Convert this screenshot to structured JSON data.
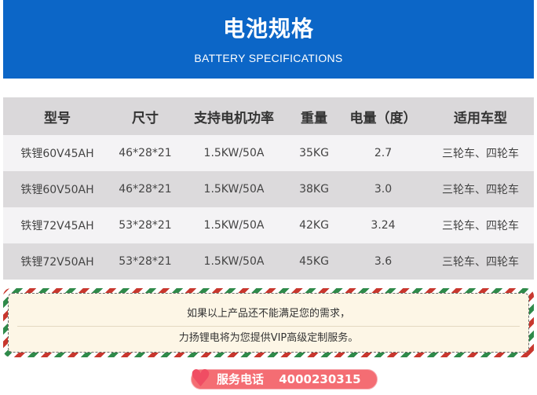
{
  "header": {
    "title": "电池规格",
    "subtitle": "BATTERY SPECIFICATIONS",
    "bg_color": "#0c66c7"
  },
  "table": {
    "columns": [
      "型号",
      "尺寸",
      "支持电机功率",
      "重量",
      "电量（度）",
      "适用车型"
    ],
    "rows": [
      [
        "铁锂60V45AH",
        "46*28*21",
        "1.5KW/50A",
        "35KG",
        "2.7",
        "三轮车、四轮车"
      ],
      [
        "铁锂60V50AH",
        "46*28*21",
        "1.5KW/50A",
        "38KG",
        "3.0",
        "三轮车、四轮车"
      ],
      [
        "铁锂72V45AH",
        "53*28*21",
        "1.5KW/50A",
        "42KG",
        "3.24",
        "三轮车、四轮车"
      ],
      [
        "铁锂72V50AH",
        "53*28*21",
        "1.5KW/50A",
        "45KG",
        "3.6",
        "三轮车、四轮车"
      ]
    ]
  },
  "note": {
    "line1": "如果以上产品还不能满足您的需求，",
    "line2": "力扬锂电将为您提供VIP高级定制服务。"
  },
  "hotline": {
    "icon": "heart-icon",
    "label": "服务电话",
    "number": "4000230315",
    "color": "#f46d73"
  }
}
